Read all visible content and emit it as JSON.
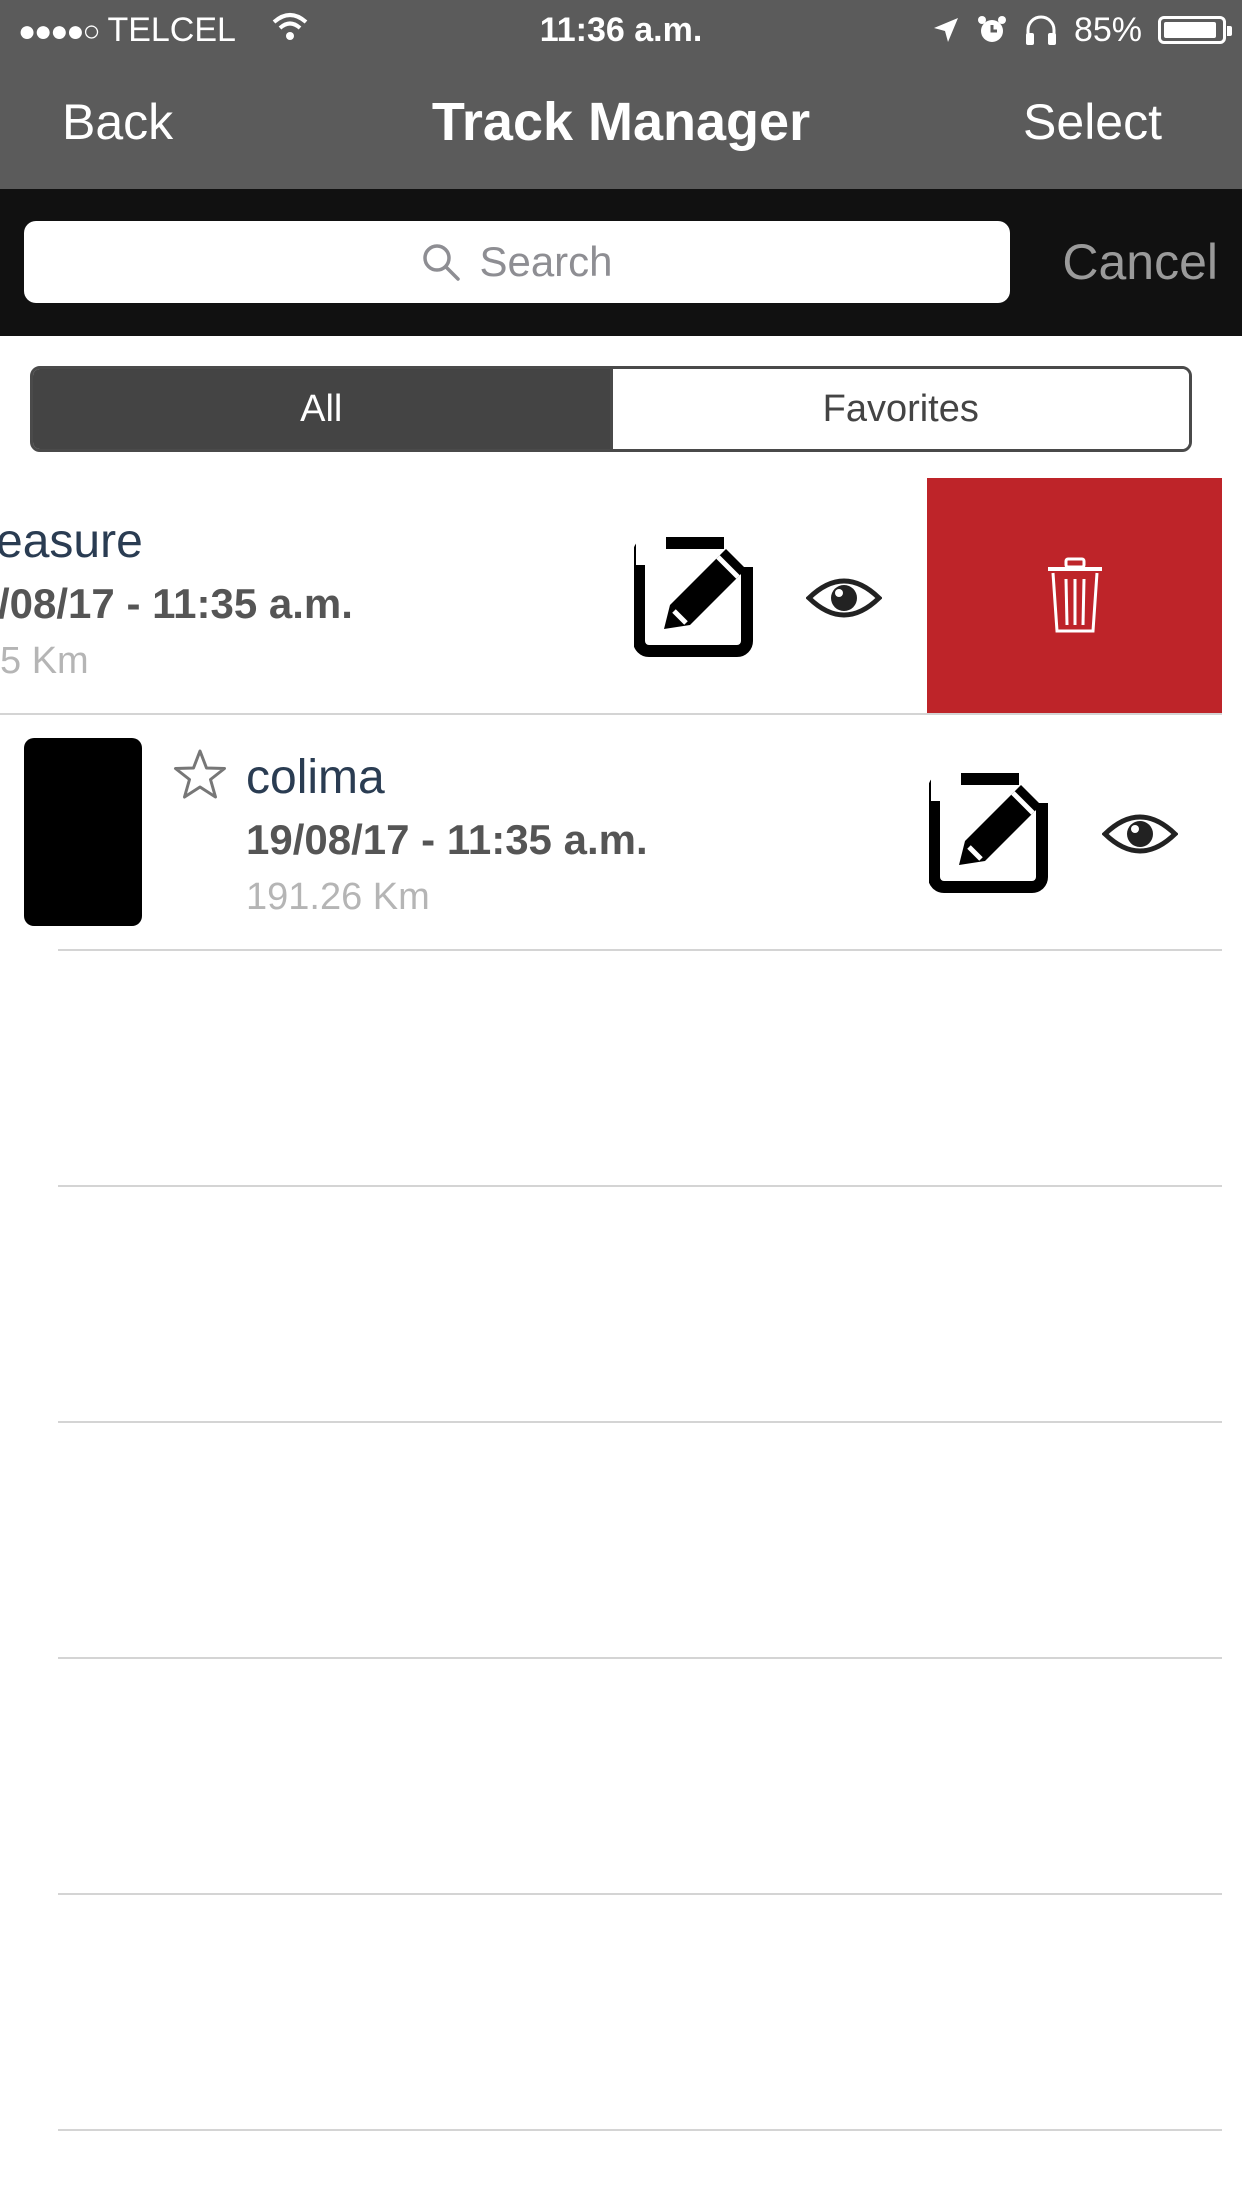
{
  "status_bar": {
    "carrier": "TELCEL",
    "time": "11:36 a.m.",
    "battery": "85%"
  },
  "nav": {
    "back_label": "Back",
    "title": "Track Manager",
    "select_label": "Select"
  },
  "search": {
    "placeholder": "Search",
    "cancel_label": "Cancel"
  },
  "segments": {
    "all_label": "All",
    "favorites_label": "Favorites",
    "selected": "All"
  },
  "tracks": [
    {
      "name": "easure",
      "date": "/08/17 - 11:35 a.m.",
      "distance": "5 Km",
      "swiped": true,
      "favorite": false
    },
    {
      "name": "colima",
      "date": "19/08/17 - 11:35 a.m.",
      "distance": "191.26 Km",
      "swiped": false,
      "favorite": false
    }
  ],
  "icons": {
    "edit": "edit-icon",
    "view": "eye-icon",
    "delete": "trash-icon",
    "favorite": "star-outline-icon"
  },
  "colors": {
    "nav_bar": "#5b5b5b",
    "search_bar": "#111111",
    "delete_action": "#be2429",
    "track_name": "#2a3c52"
  }
}
